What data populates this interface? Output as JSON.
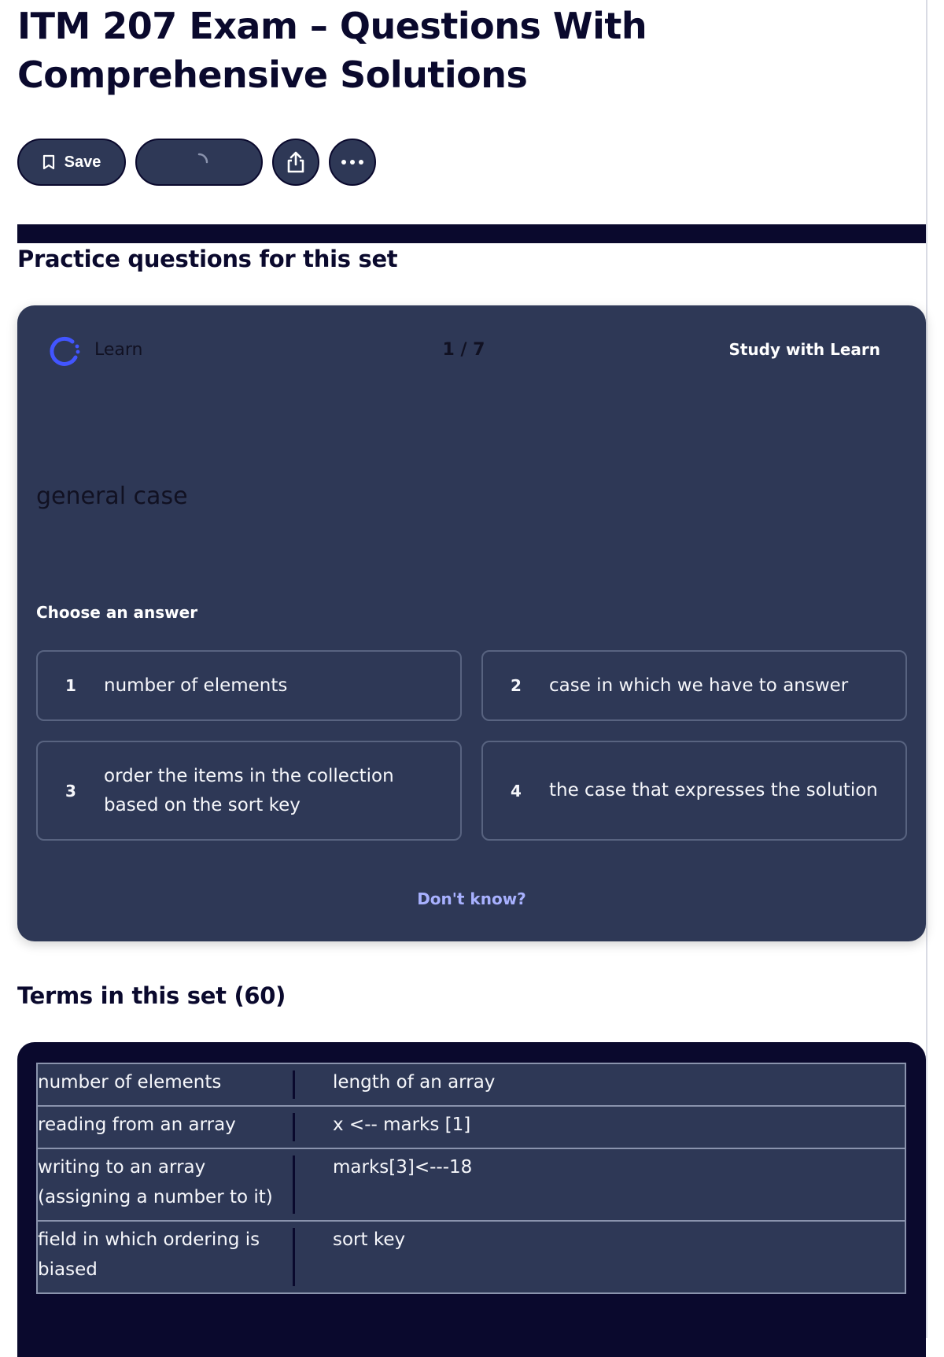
{
  "page": {
    "title": "ITM 207 Exam – Questions With Comprehensive Solutions"
  },
  "actions": {
    "save_label": "Save",
    "icons": [
      "bookmark-icon",
      "loading-spinner-icon",
      "share-icon",
      "more-icon"
    ]
  },
  "practice": {
    "heading": "Practice questions for this set",
    "mode_label": "Learn",
    "counter": "1 / 7",
    "study_link": "Study with Learn",
    "prompt": "general case",
    "choose_label": "Choose an answer",
    "answers": [
      {
        "num": "1",
        "text": "number of elements"
      },
      {
        "num": "2",
        "text": "case in which we have to answer"
      },
      {
        "num": "3",
        "text": "order the items in the collection based on the sort key"
      },
      {
        "num": "4",
        "text": "the case that expresses the solution"
      }
    ],
    "dont_know": "Don't know?"
  },
  "terms": {
    "heading": "Terms in this set (60)",
    "rows": [
      {
        "term": "number of elements",
        "definition": "length of an array"
      },
      {
        "term": "reading from an array",
        "definition": "x <-- marks [1]"
      },
      {
        "term": "writing to an array (assigning a number to it)",
        "definition": "marks[3]<---18"
      },
      {
        "term": "field in which ordering is biased",
        "definition": "sort key"
      }
    ]
  },
  "colors": {
    "card_bg": "#2e3856",
    "dark_navy": "#0a092d",
    "accent_link": "#a8b1ff",
    "learn_icon": "#4255ff"
  }
}
